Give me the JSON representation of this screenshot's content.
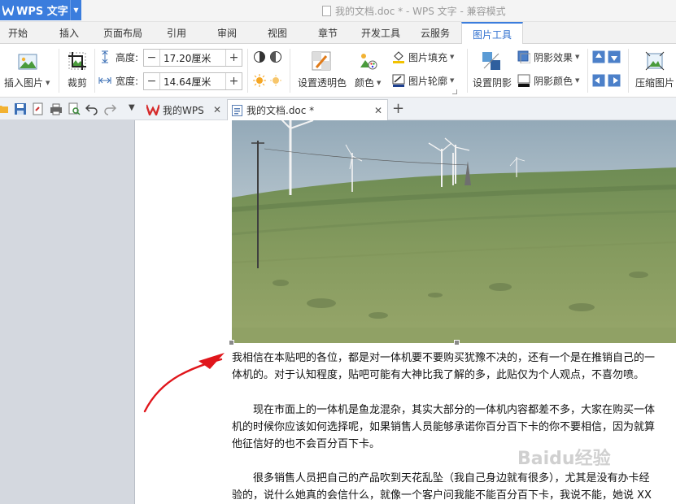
{
  "app": {
    "name": "WPS 文字",
    "window_title": "我的文档.doc * - WPS 文字 - 兼容模式"
  },
  "menu_tabs": [
    "开始",
    "插入",
    "页面布局",
    "引用",
    "审阅",
    "视图",
    "章节",
    "开发工具",
    "云服务",
    "图片工具"
  ],
  "active_tab": "图片工具",
  "ribbon": {
    "insert_picture": "插入图片",
    "crop": "裁剪",
    "height_label": "高度:",
    "height_value": "17.20厘米",
    "width_label": "宽度:",
    "width_value": "14.64厘米",
    "set_transparent": "设置透明色",
    "color": "颜色",
    "picture_fill": "图片填充",
    "picture_outline": "图片轮廓",
    "set_shadow": "设置阴影",
    "shadow_effect": "阴影效果",
    "shadow_color": "阴影颜色",
    "compress_picture": "压缩图片"
  },
  "doc_tabs": [
    {
      "label": "我的WPS"
    },
    {
      "label": "我的文档.doc *"
    }
  ],
  "document": {
    "paragraphs": [
      [
        "我相信在本贴吧的各位，都是对一体机要不要购买犹豫不决的，还有一个是在推销自己的一",
        "体机的。对于认知程度，贴吧可能有大神比我了解的多，此贴仅为个人观点，不喜勿喷。"
      ],
      [
        "　　现在市面上的一体机是鱼龙混杂，其实大部分的一体机内容都差不多，大家在购买一体",
        "机的时候你应该如何选择呢，如果销售人员能够承诺你百分百下卡的你不要相信，因为就算",
        "他征信好的也不会百分百下卡。"
      ],
      [
        "　　很多销售人员把自己的产品吹到天花乱坠（我自己身边就有很多），尤其是没有办卡经",
        "验的，说什么她真的会信什么，就像一个客户问我能不能百分百下卡，我说不能，她说 XX"
      ]
    ],
    "watermark": "Baidu经验"
  },
  "colors": {
    "accent": "#3b7ddd",
    "annotation": "#e0151b"
  }
}
